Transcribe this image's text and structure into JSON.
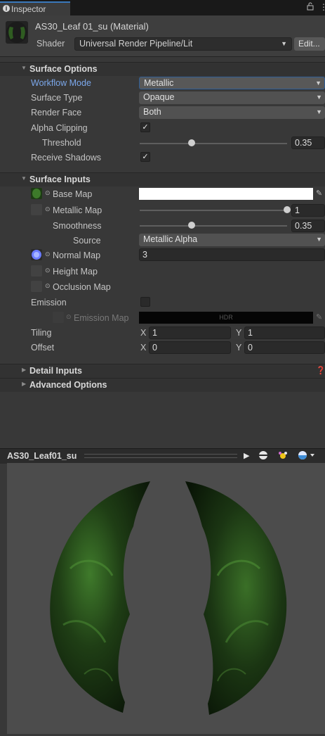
{
  "tab": {
    "title": "Inspector",
    "lock_icon": "lock-icon",
    "menu_icon": "kebab-menu-icon"
  },
  "header": {
    "material_name": "AS30_Leaf 01_su (Material)",
    "shader_label": "Shader",
    "shader_value": "Universal Render Pipeline/Lit",
    "edit_label": "Edit..."
  },
  "surface_options": {
    "title": "Surface Options",
    "workflow_mode": {
      "label": "Workflow Mode",
      "value": "Metallic"
    },
    "surface_type": {
      "label": "Surface Type",
      "value": "Opaque"
    },
    "render_face": {
      "label": "Render Face",
      "value": "Both"
    },
    "alpha_clipping": {
      "label": "Alpha Clipping",
      "checked": true
    },
    "threshold": {
      "label": "Threshold",
      "value": "0.35",
      "fraction": 0.35
    },
    "receive_shadows": {
      "label": "Receive Shadows",
      "checked": true
    }
  },
  "surface_inputs": {
    "title": "Surface Inputs",
    "base_map": {
      "label": "Base Map",
      "color": "#ffffff"
    },
    "metallic_map": {
      "label": "Metallic Map",
      "value": "1",
      "fraction": 1.0
    },
    "smoothness": {
      "label": "Smoothness",
      "value": "0.35",
      "fraction": 0.35
    },
    "source": {
      "label": "Source",
      "value": "Metallic Alpha"
    },
    "normal_map": {
      "label": "Normal Map",
      "value": "3"
    },
    "height_map": {
      "label": "Height Map"
    },
    "occlusion_map": {
      "label": "Occlusion Map"
    },
    "emission": {
      "label": "Emission",
      "checked": false
    },
    "emission_map": {
      "label": "Emission Map",
      "hdr": "HDR"
    },
    "tiling": {
      "label": "Tiling",
      "x_label": "X",
      "x": "1",
      "y_label": "Y",
      "y": "1"
    },
    "offset": {
      "label": "Offset",
      "x_label": "X",
      "x": "0",
      "y_label": "Y",
      "y": "0"
    }
  },
  "collapsed_sections": {
    "detail_inputs": "Detail Inputs",
    "advanced_options": "Advanced Options"
  },
  "preview": {
    "title": "AS30_Leaf01_su",
    "icons": [
      "play-icon",
      "sphere-icon",
      "light-icon",
      "preview-shape-dropdown-icon"
    ]
  },
  "colors": {
    "accent": "#3a79bb",
    "label_active": "#7ba7ea",
    "leaf_green": "#2e5a1e"
  }
}
